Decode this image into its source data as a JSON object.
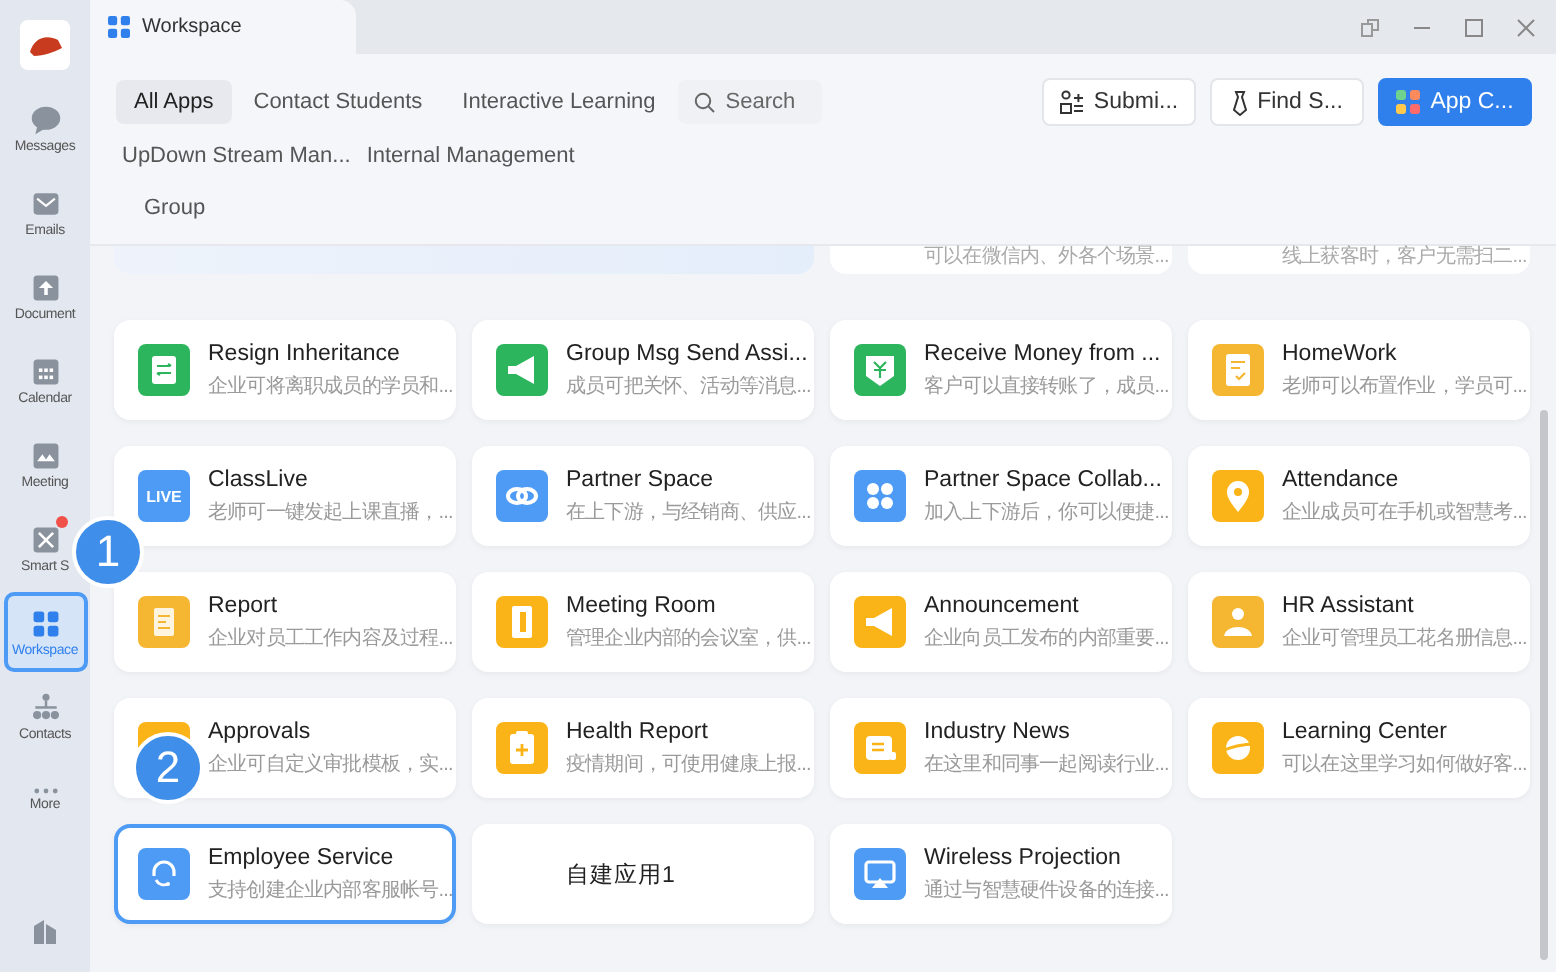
{
  "window": {
    "title": "Workspace"
  },
  "sidebar": {
    "items": [
      {
        "label": "Messages",
        "selected": false,
        "badge": false
      },
      {
        "label": "Emails",
        "selected": false,
        "badge": false
      },
      {
        "label": "Document",
        "selected": false,
        "badge": false
      },
      {
        "label": "Calendar",
        "selected": false,
        "badge": false
      },
      {
        "label": "Meeting",
        "selected": false,
        "badge": false
      },
      {
        "label": "Smart S",
        "selected": false,
        "badge": true
      },
      {
        "label": "Workspace",
        "selected": true,
        "badge": false
      },
      {
        "label": "Contacts",
        "selected": false,
        "badge": false
      },
      {
        "label": "More",
        "selected": false,
        "badge": false
      }
    ]
  },
  "tabs": [
    {
      "label": "All Apps",
      "selected": true
    },
    {
      "label": "Contact Students",
      "selected": false
    },
    {
      "label": "Interactive Learning",
      "selected": false
    },
    {
      "label": "UpDown Stream Man...",
      "selected": false
    },
    {
      "label": "Internal Management",
      "selected": false
    },
    {
      "label": "Group",
      "selected": false
    }
  ],
  "search": {
    "placeholder": "Search"
  },
  "actions": [
    {
      "label": "Submi...",
      "kind": "outline"
    },
    {
      "label": "Find S...",
      "kind": "outline"
    },
    {
      "label": "App C...",
      "kind": "primary"
    }
  ],
  "partial_cards": [
    {
      "description": "可以在微信内、外各个场景..."
    },
    {
      "description": "线上获客时，客户无需扫二..."
    }
  ],
  "apps": [
    {
      "name": "Resign Inheritance",
      "description": "企业可将离职成员的学员和...",
      "color": "#2db55d",
      "selected": false
    },
    {
      "name": "Group Msg Send Assi...",
      "description": "成员可把关怀、活动等消息...",
      "color": "#2db55d",
      "selected": false
    },
    {
      "name": "Receive Money from ...",
      "description": "客户可以直接转账了，成员...",
      "color": "#2db55d",
      "selected": false
    },
    {
      "name": "HomeWork",
      "description": "老师可以布置作业，学员可...",
      "color": "#f5b731",
      "selected": false
    },
    {
      "name": "ClassLive",
      "description": "老师可一键发起上课直播，...",
      "icon_text": "LIVE",
      "color": "#4e9bf5",
      "selected": false
    },
    {
      "name": "Partner Space",
      "description": "在上下游，与经销商、供应...",
      "color": "#4e9bf5",
      "selected": false
    },
    {
      "name": "Partner Space Collab...",
      "description": "加入上下游后，你可以便捷...",
      "color": "#4e9bf5",
      "selected": false
    },
    {
      "name": "Attendance",
      "description": "企业成员可在手机或智慧考...",
      "color": "#fbb417",
      "selected": false
    },
    {
      "name": "Report",
      "description": "企业对员工工作内容及过程...",
      "color": "#f5b731",
      "selected": false
    },
    {
      "name": "Meeting Room",
      "description": "管理企业内部的会议室，供...",
      "color": "#fbb417",
      "selected": false
    },
    {
      "name": "Announcement",
      "description": "企业向员工发布的内部重要...",
      "color": "#fbb417",
      "selected": false
    },
    {
      "name": "HR Assistant",
      "description": "企业可管理员工花名册信息...",
      "color": "#f5b731",
      "selected": false
    },
    {
      "name": "Approvals",
      "description": "企业可自定义审批模板，实...",
      "color": "#fbb417",
      "selected": false
    },
    {
      "name": "Health Report",
      "description": "疫情期间，可使用健康上报...",
      "color": "#fbb417",
      "selected": false
    },
    {
      "name": "Industry News",
      "description": "在这里和同事一起阅读行业...",
      "color": "#fbb417",
      "selected": false
    },
    {
      "name": "Learning Center",
      "description": "可以在这里学习如何做好客...",
      "color": "#fbb417",
      "selected": false
    },
    {
      "name": "Employee Service",
      "description": "支持创建企业内部客服帐号...",
      "color": "#4e9bf5",
      "selected": true
    },
    {
      "name": "自建应用1",
      "selected": false
    },
    {
      "name": "Wireless Projection",
      "description": "通过与智慧硬件设备的连接...",
      "color": "#4e9bf5",
      "selected": false
    }
  ],
  "callouts": [
    {
      "label": "1"
    },
    {
      "label": "2"
    }
  ]
}
